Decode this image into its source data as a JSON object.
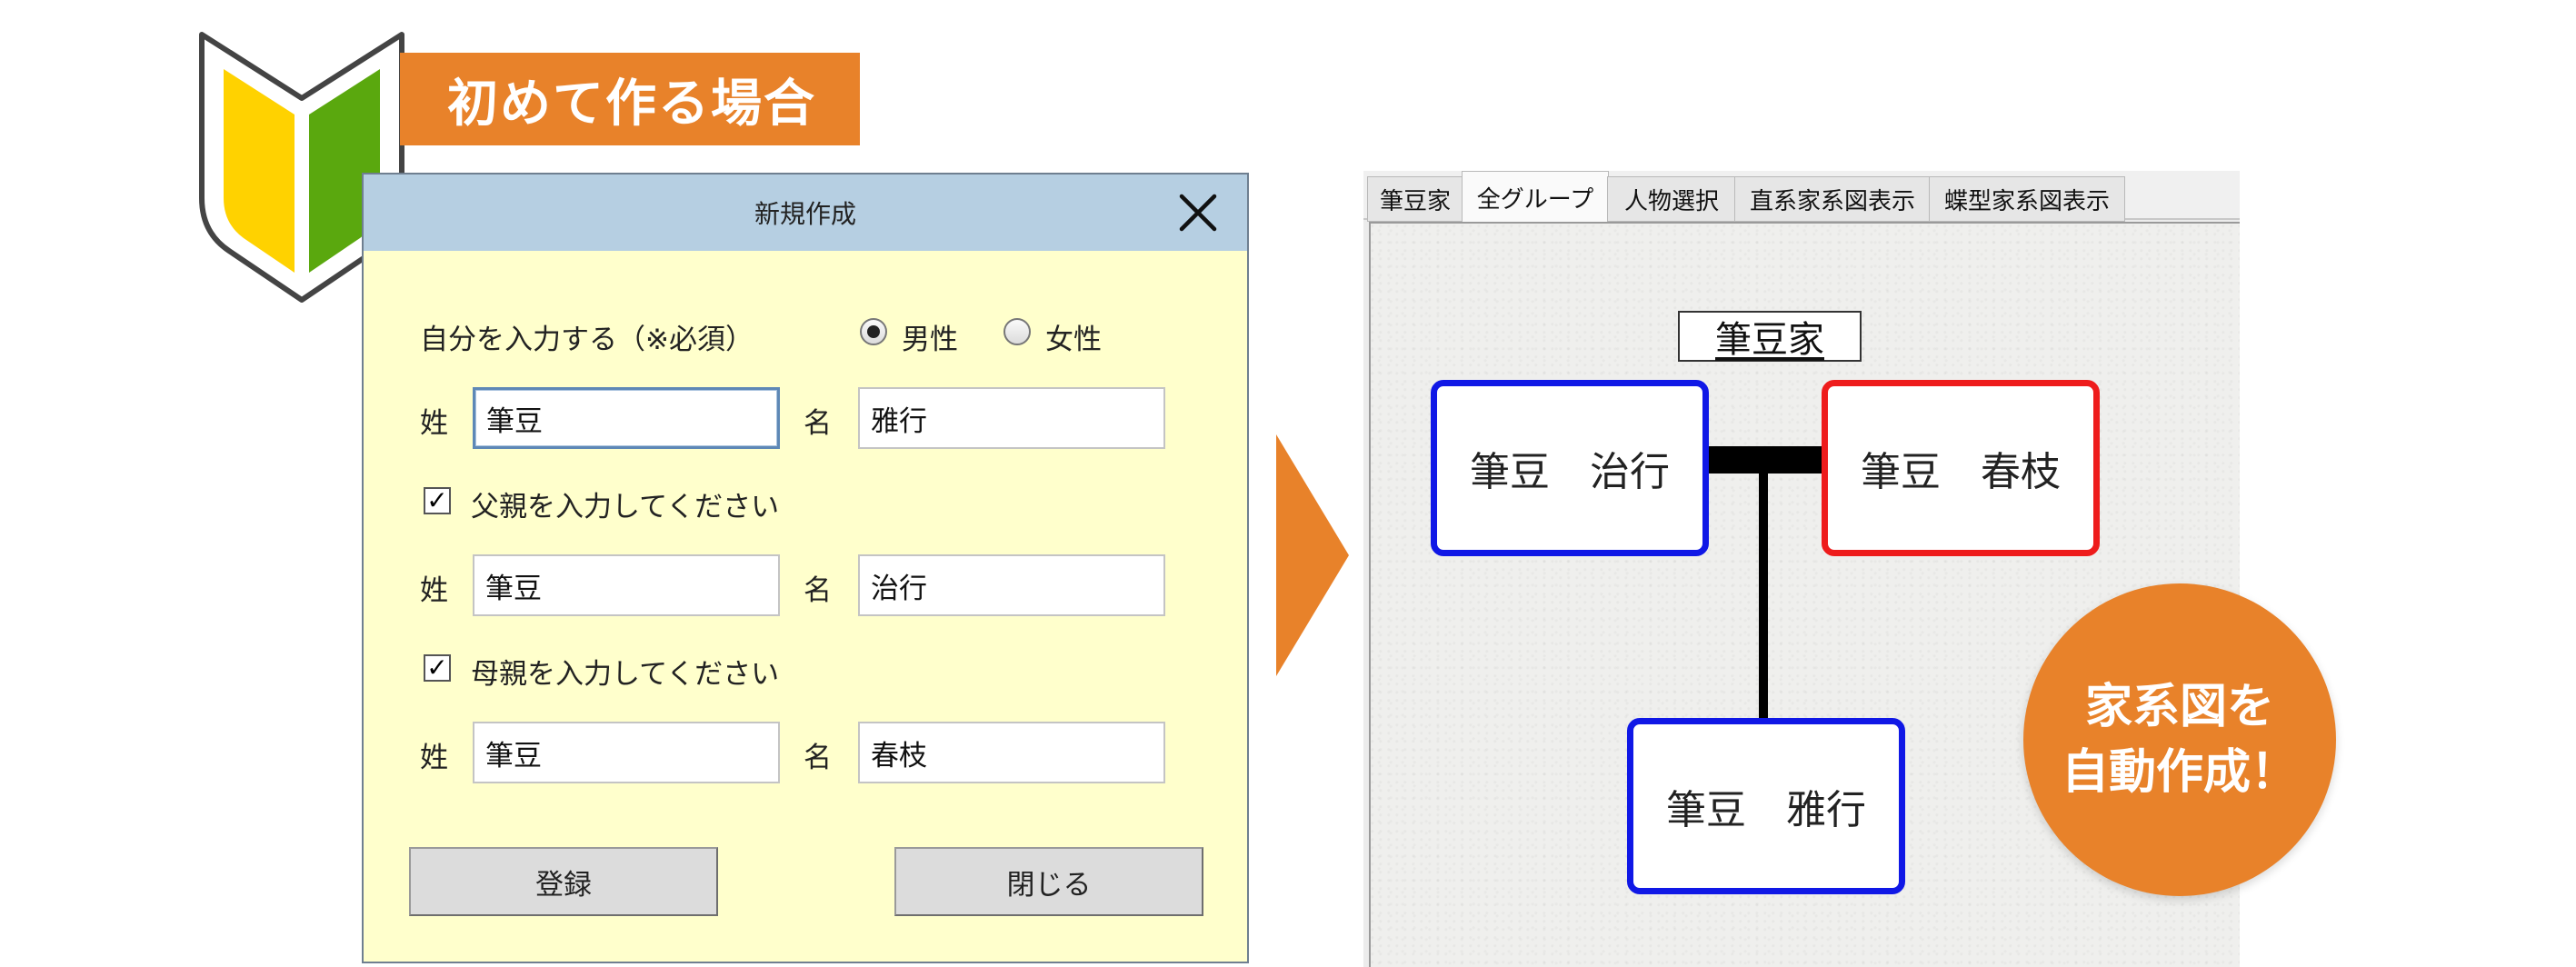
{
  "banner": {
    "text": "初めて作る場合"
  },
  "dialog": {
    "title": "新規作成",
    "self_label": "自分を入力する（※必須）",
    "gender_options": [
      "男性",
      "女性"
    ],
    "gender_selected": "男性",
    "surname_label": "姓",
    "given_label": "名",
    "self": {
      "surname": "筆豆",
      "given": "雅行"
    },
    "father_checkbox": {
      "label": "父親を入力してください",
      "checked": true
    },
    "father": {
      "surname": "筆豆",
      "given": "治行"
    },
    "mother_checkbox": {
      "label": "母親を入力してください",
      "checked": true
    },
    "mother": {
      "surname": "筆豆",
      "given": "春枝"
    },
    "register_button": "登録",
    "close_button": "閉じる"
  },
  "tree_panel": {
    "tabs": [
      "筆豆家",
      "全グループ",
      "人物選択",
      "直系家系図表示",
      "蝶型家系図表示"
    ],
    "active_tab": "全グループ",
    "family_name": "筆豆家",
    "father_card": "筆豆　治行",
    "mother_card": "筆豆　春枝",
    "child_card": "筆豆　雅行"
  },
  "badge": {
    "line1": "家系図を",
    "line2": "自動作成！"
  },
  "colors": {
    "accent_orange": "#e8822a",
    "male_border": "#1018e6",
    "female_border": "#ee1c1c",
    "dialog_bg": "#ffffcc",
    "titlebar_bg": "#b6cfe2",
    "mark_yellow": "#ffd200",
    "mark_green": "#5aa80e"
  },
  "icons": {
    "beginner_mark": "beginner-mark-icon",
    "close": "close-icon",
    "arrow": "arrow-right-icon"
  }
}
